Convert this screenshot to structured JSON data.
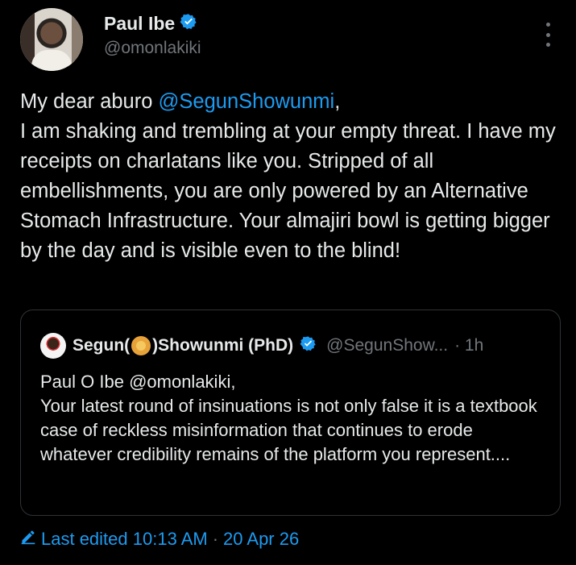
{
  "author": {
    "name": "Paul Ibe",
    "handle": "@omonlakiki",
    "verified": true
  },
  "tweet": {
    "text_prefix": "My dear aburo ",
    "mention": "@SegunShowunmi",
    "text_body": ",\nI am shaking and trembling at your empty threat. I have my receipts on charlatans like you. Stripped of all embellishments, you are only powered by an Alternative Stomach Infrastructure. Your almajiri bowl is getting bigger by the day and is visible even to the blind!"
  },
  "quoted_tweet": {
    "name_before_emoji": "Segun(",
    "name_emoji": "lion-face-icon",
    "name_after_emoji": ")Showunmi (PhD)",
    "verified": true,
    "handle": "@SegunShow...",
    "time": "· 1h",
    "text": "Paul O Ibe @omonlakiki,\nYour latest round of insinuations is not only false it is a textbook case of reckless misinformation that continues to erode whatever credibility remains of the platform you represent...."
  },
  "edit_info": {
    "label": "Last edited 10:13 AM",
    "separator": "·",
    "date": "20 Apr 26"
  },
  "colors": {
    "accent": "#1d9bf0",
    "text": "#e7e9ea",
    "muted": "#71767b",
    "background": "#000000",
    "border": "#2f3336"
  }
}
